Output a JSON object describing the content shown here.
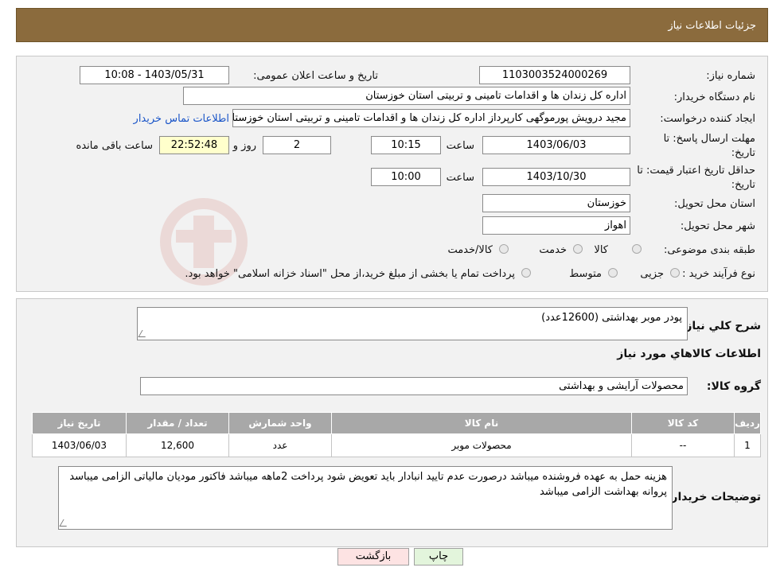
{
  "header": {
    "title": "جزئیات اطلاعات نیاز"
  },
  "form": {
    "need_number_label": "شماره نیاز:",
    "need_number": "1103003524000269",
    "announce_label": "تاریخ و ساعت اعلان عمومی:",
    "announce_value": "1403/05/31 - 10:08",
    "buyer_label": "نام دستگاه خریدار:",
    "buyer_value": "اداره کل زندان ها و اقدامات تامینی و تربیتی استان خوزستان",
    "creator_label": "ایجاد کننده درخواست:",
    "creator_value": "مجید درویش پورموگهی کارپرداز اداره کل زندان ها و اقدامات تامینی و تربیتی استان خوزستان",
    "contact_link": "اطلاعات تماس خریدار",
    "deadline_label_1": "مهلت ارسال پاسخ: تا",
    "deadline_label_2": "تاریخ:",
    "deadline_date": "1403/06/03",
    "time_label": "ساعت",
    "deadline_time": "10:15",
    "days_value": "2",
    "days_label": "روز و",
    "remaining_time": "22:52:48",
    "remaining_label": "ساعت باقی مانده",
    "validity_label_1": "حداقل تاریخ اعتبار قیمت: تا",
    "validity_label_2": "تاریخ:",
    "validity_date": "1403/10/30",
    "validity_time": "10:00",
    "province_label": "استان محل تحویل:",
    "province_value": "خوزستان",
    "city_label": "شهر محل تحویل:",
    "city_value": "اهواز",
    "category_label": "طبقه بندی موضوعی:",
    "category_options": [
      "کالا",
      "خدمت",
      "کالا/خدمت"
    ],
    "process_label": "نوع فرآیند خرید :",
    "process_options": [
      "جزیی",
      "متوسط"
    ],
    "process_note": "پرداخت تمام یا بخشی از مبلغ خرید،از محل \"اسناد خزانه اسلامی\" خواهد بود."
  },
  "details": {
    "summary_label": "شرح کلي نياز:",
    "summary_value": "پودر موبر بهداشتی (12600عدد)",
    "goods_info_title": "اطلاعات کالاهاي مورد نياز",
    "group_label": "گروه کالا:",
    "group_value": "محصولات آرایشی و بهداشتی",
    "table": {
      "headers": [
        "رديف",
        "کد کالا",
        "نام کالا",
        "واحد شمارش",
        "تعداد / مقدار",
        "تاريخ نياز"
      ],
      "rows": [
        [
          "1",
          "--",
          "محصولات موبر",
          "عدد",
          "12,600",
          "1403/06/03"
        ]
      ]
    },
    "buyer_notes_label": "توضيحات خريدار:",
    "buyer_notes_value": "هزینه حمل به عهده فروشنده میباشد درصورت عدم تایید انبادار باید تعویض شود پرداخت 2ماهه میباشد فاکتور مودیان مالیاتی الزامی میباسد پروانه بهداشت الزامی میباشد"
  },
  "buttons": {
    "print": "چاپ",
    "back": "بازگشت"
  },
  "colors": {
    "header_bg": "#8b6b3d",
    "link": "#1a55c8",
    "yellow_field": "#ffffcc",
    "back_btn": "#fde3e3",
    "print_btn": "#e3f5dc"
  }
}
